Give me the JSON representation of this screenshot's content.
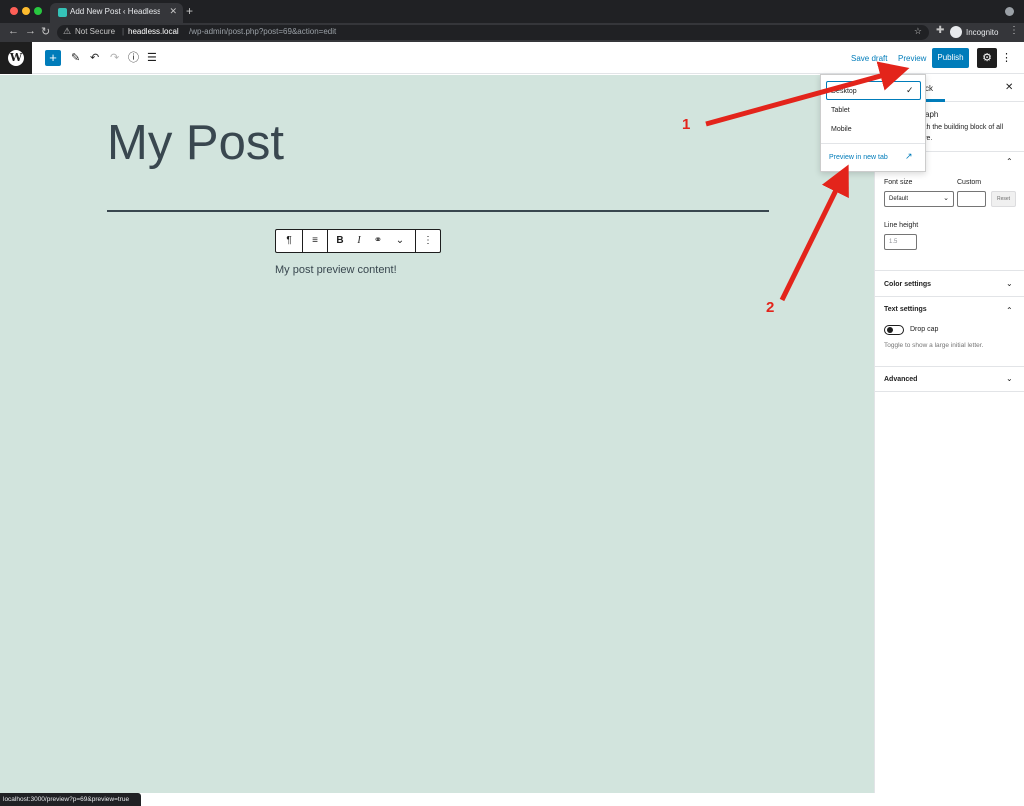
{
  "browser": {
    "tab_title": "Add New Post ‹ Headless Local",
    "security_label": "Not Secure",
    "url_host": "headless.local",
    "url_path": "/wp-admin/post.php?post=69&action=edit",
    "profile_label": "Incognito",
    "status_url": "localhost:3000/preview?p=69&preview=true"
  },
  "editor_header": {
    "save_draft_label": "Save draft",
    "preview_label": "Preview",
    "publish_label": "Publish"
  },
  "canvas": {
    "post_title": "My Post",
    "paragraph_text": "My post preview content!",
    "background_color": "#d2e4dd"
  },
  "preview_menu": {
    "items": [
      "Desktop",
      "Tablet",
      "Mobile"
    ],
    "selected": "Desktop",
    "new_tab_label": "Preview in new tab"
  },
  "sidebar": {
    "tab_label_visible": "ck",
    "block_name_visible": "aph",
    "block_desc_visible": "ith the building block of all",
    "block_desc_visible_2": "ve.",
    "typography": {
      "font_size_label": "Font size",
      "font_size_value": "Default",
      "custom_label": "Custom",
      "reset_label": "Reset",
      "line_height_label": "Line height",
      "line_height_placeholder": "1.5"
    },
    "color_settings_label": "Color settings",
    "text_settings_label": "Text settings",
    "drop_cap_label": "Drop cap",
    "drop_cap_help": "Toggle to show a large initial letter.",
    "advanced_label": "Advanced"
  },
  "annotations": {
    "label_1": "1",
    "label_2": "2",
    "arrow_color": "#e3241b"
  },
  "icons": {
    "toolbar": [
      "plus-icon",
      "pencil-icon",
      "undo-icon",
      "redo-icon",
      "info-icon",
      "list-view-icon"
    ],
    "block_toolbar": [
      "paragraph-icon",
      "align-icon",
      "bold-icon",
      "italic-icon",
      "link-icon",
      "chevron-down-icon",
      "more-icon"
    ]
  }
}
